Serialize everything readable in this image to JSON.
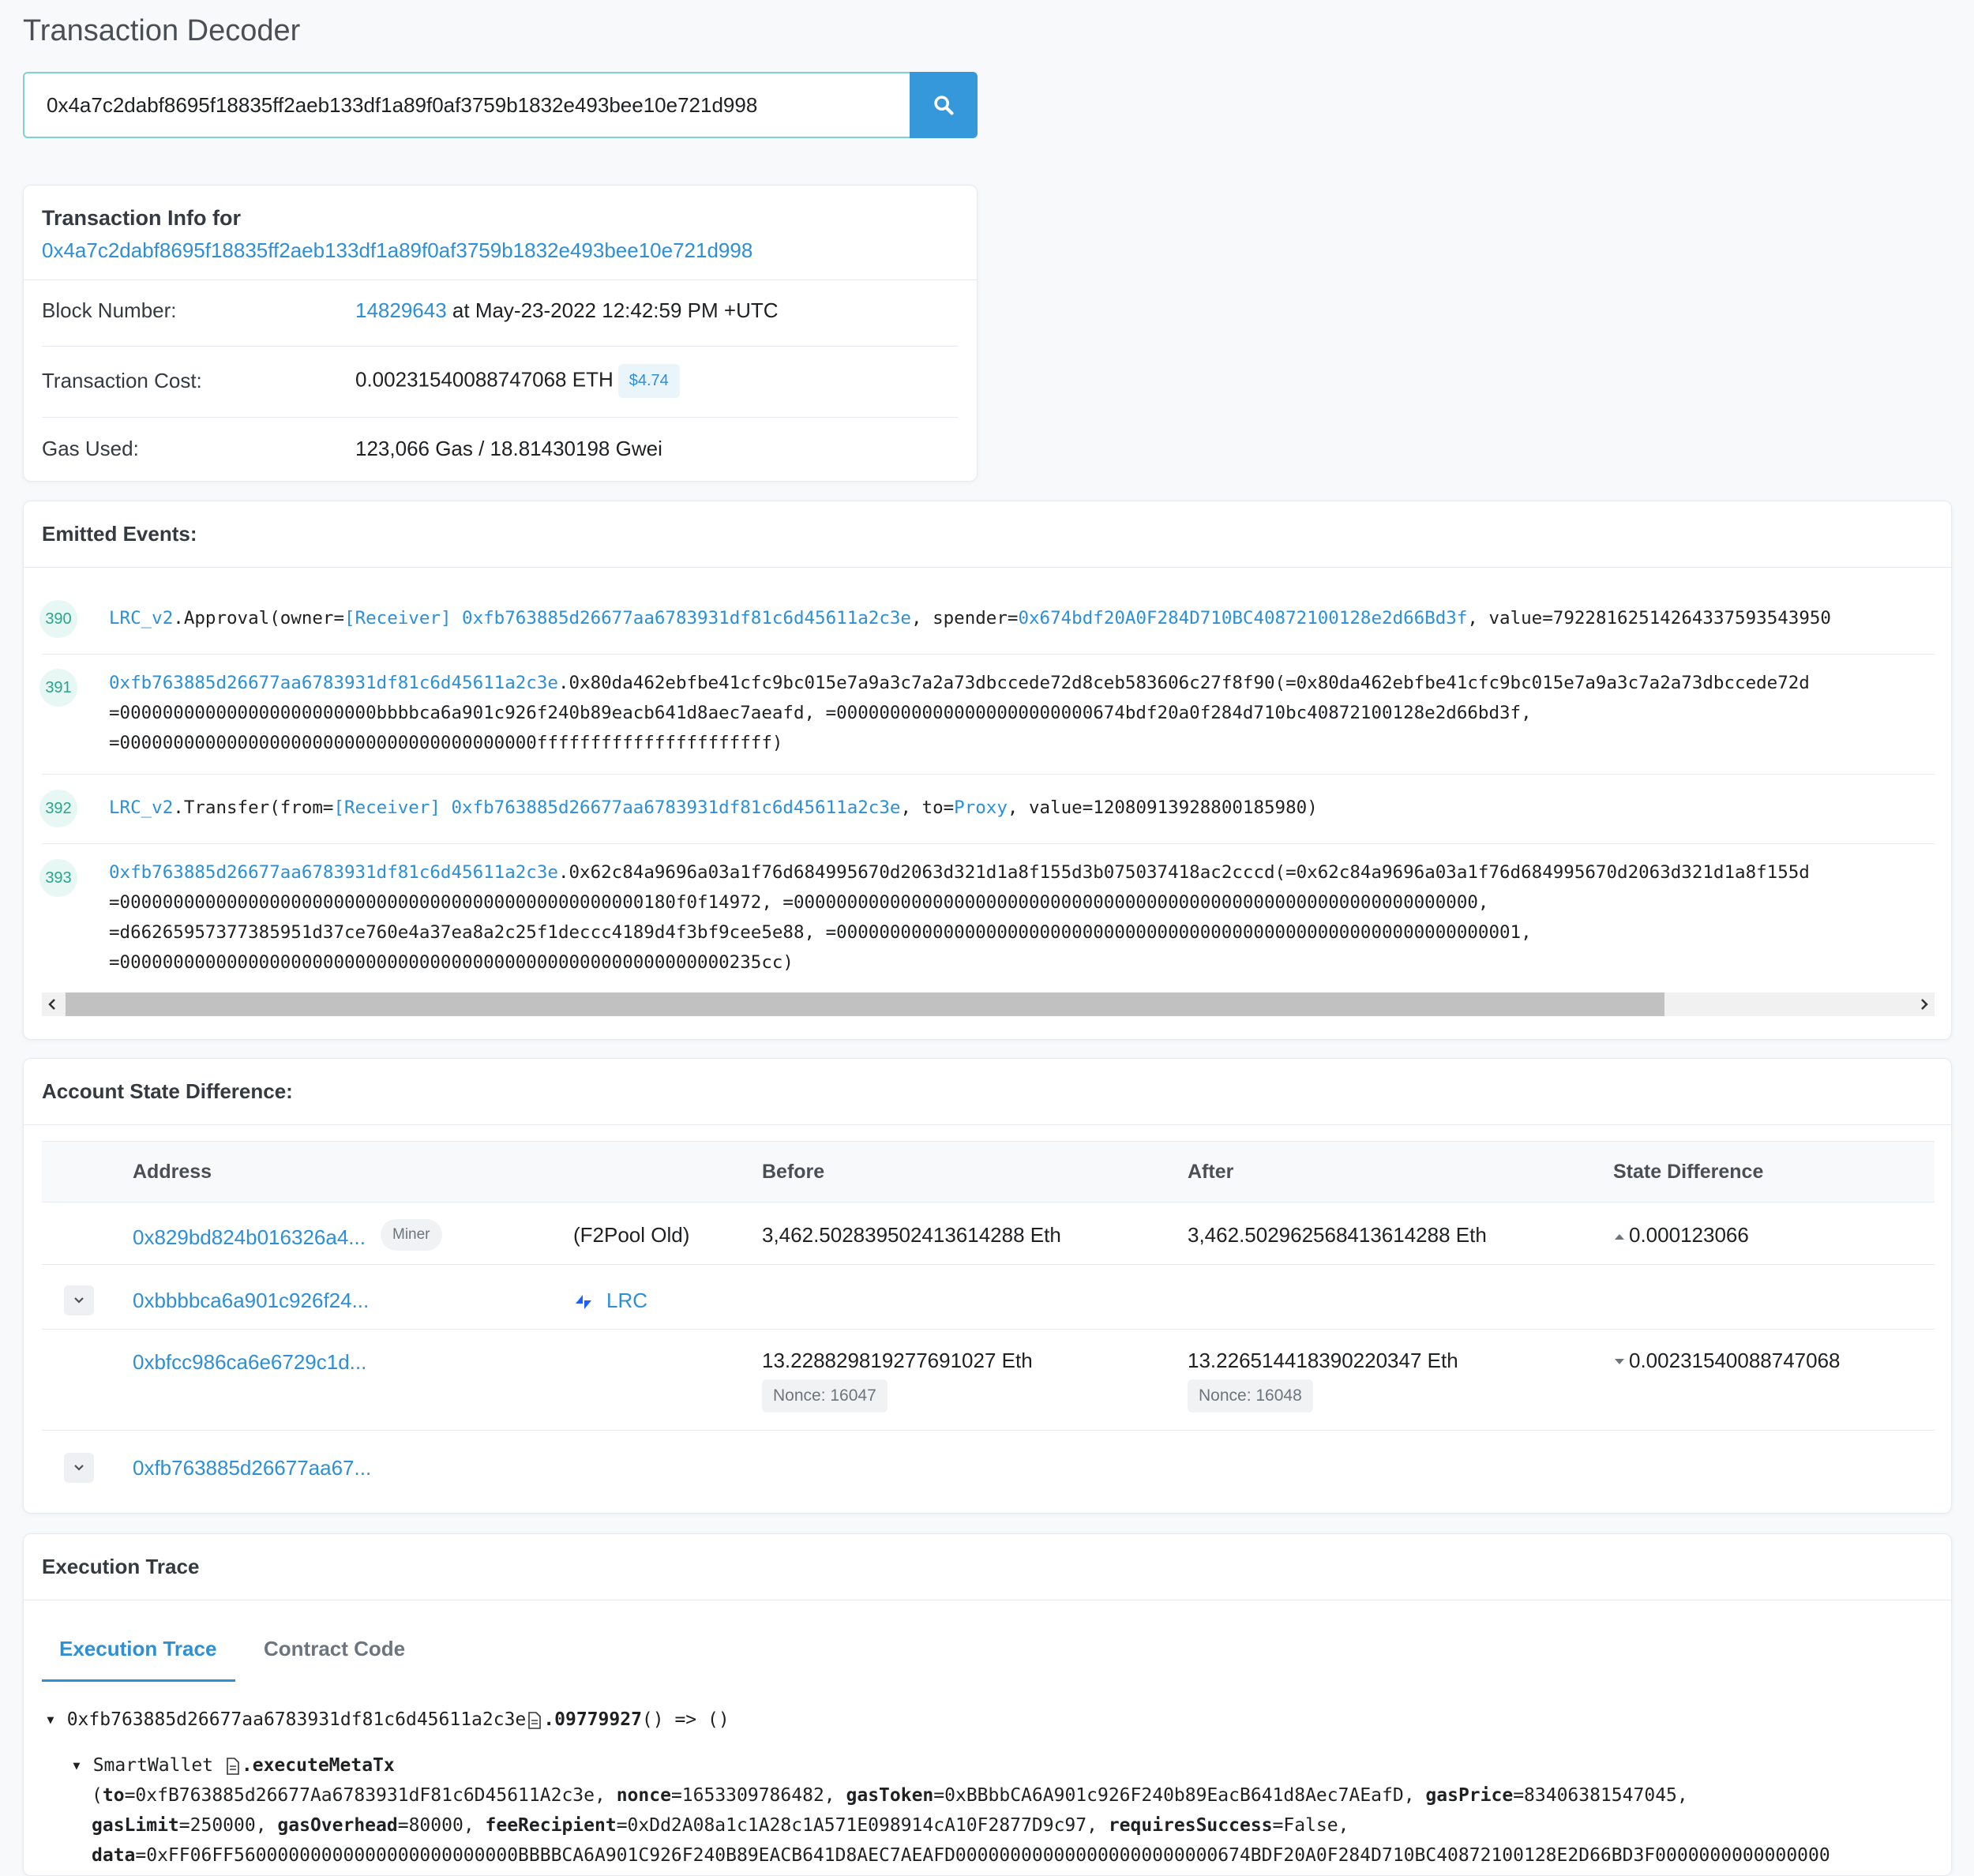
{
  "page": {
    "title": "Transaction Decoder"
  },
  "search": {
    "value": "0x4a7c2dabf8695f18835ff2aeb133df1a89f0af3759b1832e493bee10e721d998",
    "button_icon": "search-icon"
  },
  "info": {
    "heading": "Transaction Info for",
    "tx_hash": "0x4a7c2dabf8695f18835ff2aeb133df1a89f0af3759b1832e493bee10e721d998",
    "block_label": "Block Number:",
    "block_number": "14829643",
    "block_time": " at May-23-2022 12:42:59 PM +UTC",
    "cost_label": "Transaction Cost:",
    "cost_value": "0.00231540088747068 ETH",
    "cost_usd": "$4.74",
    "gas_label": "Gas Used:",
    "gas_value": "123,066 Gas / 18.81430198 Gwei"
  },
  "events": {
    "heading": "Emitted Events:",
    "items": [
      {
        "num": "390"
      },
      {
        "num": "391"
      },
      {
        "num": "392"
      },
      {
        "num": "393"
      }
    ],
    "e390": {
      "contract": "LRC_v2",
      "p1": ".Approval(owner=",
      "owner": "[Receiver] 0xfb763885d26677aa6783931df81c6d45611a2c3e",
      "p2": ", spender=",
      "spender": "0x674bdf20A0F284D710BC40872100128e2d66Bd3f",
      "p3": ", value=79228162514264337593543950"
    },
    "e391": {
      "addr": "0xfb763885d26677aa6783931df81c6d45611a2c3e",
      "l1": ".0x80da462ebfbe41cfc9bc015e7a9a3c7a2a73dbccede72d8ceb583606c27f8f90(=0x80da462ebfbe41cfc9bc015e7a9a3c7a2a73dbccede72d",
      "l2": "=000000000000000000000000bbbbca6a901c926f240b89eacb641d8aec7aeafd, =000000000000000000000000674bdf20a0f284d710bc40872100128e2d66bd3f,",
      "l3": "=000000000000000000000000000000000000000ffffffffffffffffffffff)"
    },
    "e392": {
      "contract": "LRC_v2",
      "p1": ".Transfer(from=",
      "from": "[Receiver] 0xfb763885d26677aa6783931df81c6d45611a2c3e",
      "p2": ", to=",
      "to": "Proxy",
      "p3": ", value=12080913928800185980)"
    },
    "e393": {
      "addr": "0xfb763885d26677aa6783931df81c6d45611a2c3e",
      "l1": ".0x62c84a9696a03a1f76d684995670d2063d321d1a8f155d3b075037418ac2cccd(=0x62c84a9696a03a1f76d684995670d2063d321d1a8f155d",
      "l2": "=0000000000000000000000000000000000000000000000000180f0f14972, =0000000000000000000000000000000000000000000000000000000000000000,",
      "l3": "=d66265957377385951d37ce760e4a37ea8a2c25f1deccc4189d4f3bf9cee5e88, =0000000000000000000000000000000000000000000000000000000000000001,",
      "l4": "=000000000000000000000000000000000000000000000000000000000235cc)"
    }
  },
  "state": {
    "heading": "Account State Difference:",
    "columns": {
      "address": "Address",
      "before": "Before",
      "after": "After",
      "diff": "State Difference"
    },
    "rows": [
      {
        "address": "0x829bd824b016326a4...",
        "badge": "Miner",
        "label": "(F2Pool Old)",
        "before": "3,462.502839502413614288 Eth",
        "after": "3,462.502962568413614288 Eth",
        "diff": "0.000123066"
      },
      {
        "address": "0xbbbbca6a901c926f24...",
        "token": "LRC"
      },
      {
        "address": "0xbfcc986ca6e6729c1d...",
        "before": "13.228829819277691027 Eth",
        "before_nonce": "Nonce: 16047",
        "after": "13.226514418390220347 Eth",
        "after_nonce": "Nonce: 16048",
        "diff": "0.00231540088747068"
      },
      {
        "address": "0xfb763885d26677aa67..."
      }
    ]
  },
  "trace": {
    "heading": "Execution Trace",
    "tabs": [
      "Execution Trace",
      "Contract Code"
    ],
    "root_addr": "0xfb763885d26677aa6783931df81c6d45611a2c3e",
    "root_method": ".09779927",
    "root_tail": "() => ()",
    "child_name": "SmartWallet",
    "child_method": ".executeMetaTx",
    "l1": {
      "a": "(",
      "k1": "to",
      "v1": "=0xfB763885d26677Aa6783931dF81c6D45611A2c3e, ",
      "k2": "nonce",
      "v2": "=1653309786482, ",
      "k3": "gasToken",
      "v3": "=0xBBbbCA6A901c926F240b89EacB641d8Aec7AEafD, ",
      "k4": "gasPrice",
      "v4": "=83406381547045,"
    },
    "l2": {
      "k1": "gasLimit",
      "v1": "=250000, ",
      "k2": "gasOverhead",
      "v2": "=80000, ",
      "k3": "feeRecipient",
      "v3": "=0xDd2A08a1c1A28c1A571E098914cA10F2877D9c97, ",
      "k4": "requiresSuccess",
      "v4": "=False,"
    },
    "l3": {
      "k1": "data",
      "v1": "=0xFF06FF56000000000000000000000000BBBBCA6A901C926F240B89EACB641D8AEC7AEAFD000000000000000000000000674BDF20A0F284D710BC40872100128E2D66BD3F0000000000000000"
    }
  }
}
